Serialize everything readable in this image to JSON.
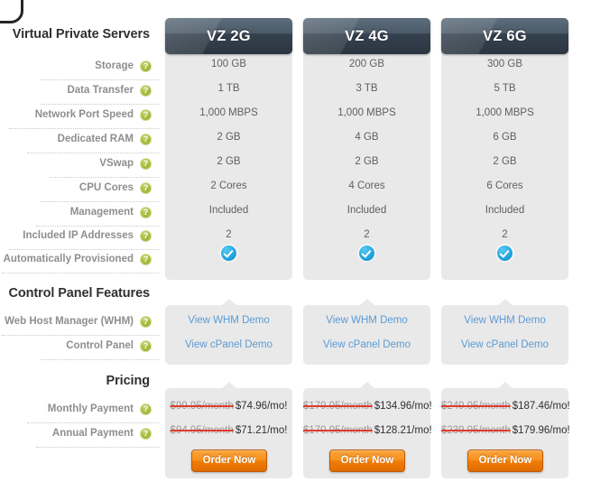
{
  "sections": {
    "vps": {
      "heading": "Virtual Private Servers"
    },
    "cpanel": {
      "heading": "Control Panel Features"
    },
    "pricing": {
      "heading": "Pricing"
    }
  },
  "spec_labels": [
    "Storage",
    "Data Transfer",
    "Network Port Speed",
    "Dedicated RAM",
    "VSwap",
    "CPU Cores",
    "Management",
    "Included IP Addresses",
    "Automatically Provisioned"
  ],
  "cpanel_labels": [
    "Web Host Manager (WHM)",
    "Control Panel"
  ],
  "pricing_labels": [
    "Monthly Payment",
    "Annual Payment"
  ],
  "help_icon": "question-mark-icon",
  "check_icon": "blue-check-icon",
  "plans": [
    {
      "name": "VZ 2G",
      "specs": [
        "100 GB",
        "1 TB",
        "1,000 MBPS",
        "2 GB",
        "2 GB",
        "2 Cores",
        "Included",
        "2"
      ],
      "provisioned": true,
      "demos": [
        "View WHM Demo",
        "View cPanel Demo"
      ],
      "monthly": {
        "old": "$99.95/month",
        "new": "$74.96/mo!"
      },
      "annual": {
        "old": "$94.95/month",
        "new": "$71.21/mo!"
      },
      "order_label": "Order Now"
    },
    {
      "name": "VZ 4G",
      "specs": [
        "200 GB",
        "3 TB",
        "1,000 MBPS",
        "4 GB",
        "2 GB",
        "4 Cores",
        "Included",
        "2"
      ],
      "provisioned": true,
      "demos": [
        "View WHM Demo",
        "View cPanel Demo"
      ],
      "monthly": {
        "old": "$179.95/month",
        "new": "$134.96/mo!"
      },
      "annual": {
        "old": "$170.95/month",
        "new": "$128.21/mo!"
      },
      "order_label": "Order Now"
    },
    {
      "name": "VZ 6G",
      "specs": [
        "300 GB",
        "5 TB",
        "1,000 MBPS",
        "6 GB",
        "2 GB",
        "6 Cores",
        "Included",
        "2"
      ],
      "provisioned": true,
      "demos": [
        "View WHM Demo",
        "View cPanel Demo"
      ],
      "monthly": {
        "old": "$249.95/month",
        "new": "$187.46/mo!"
      },
      "annual": {
        "old": "$239.95/month",
        "new": "$179.96/mo!"
      },
      "order_label": "Order Now"
    }
  ],
  "colors": {
    "panel_bg": "#e9e9e9",
    "header_dark": "#2b3641",
    "link_blue": "#5b9bd5",
    "order_orange": "#f7921e",
    "strike_red": "#e03b2f",
    "help_green": "#a4bb3c",
    "check_blue": "#25a8e0"
  }
}
